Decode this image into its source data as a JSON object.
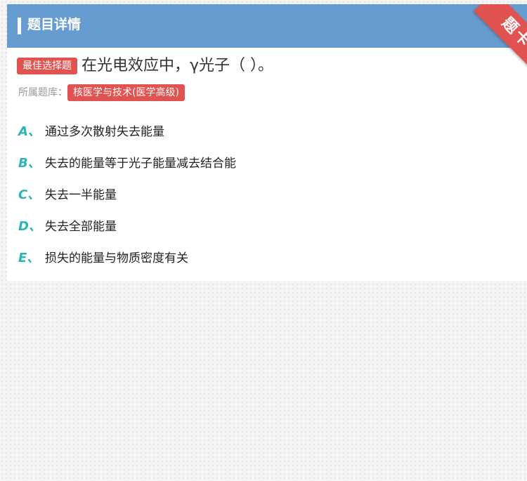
{
  "header": {
    "title": "题目详情",
    "corner_label": "题卡"
  },
  "question": {
    "type_badge": "最佳选择题",
    "text": "在光电效应中，γ光子（ ）。"
  },
  "bank": {
    "label": "所属题库：",
    "value": "核医学与技术(医学高级)"
  },
  "options": [
    {
      "letter": "A、",
      "text": "通过多次散射失去能量"
    },
    {
      "letter": "B、",
      "text": "失去的能量等于光子能量减去结合能"
    },
    {
      "letter": "C、",
      "text": "失去一半能量"
    },
    {
      "letter": "D、",
      "text": "失去全部能量"
    },
    {
      "letter": "E、",
      "text": "损失的能量与物质密度有关"
    }
  ],
  "colors": {
    "header_bg": "#679cd0",
    "accent_red": "#e05350",
    "option_letter": "#2ab4b5"
  }
}
